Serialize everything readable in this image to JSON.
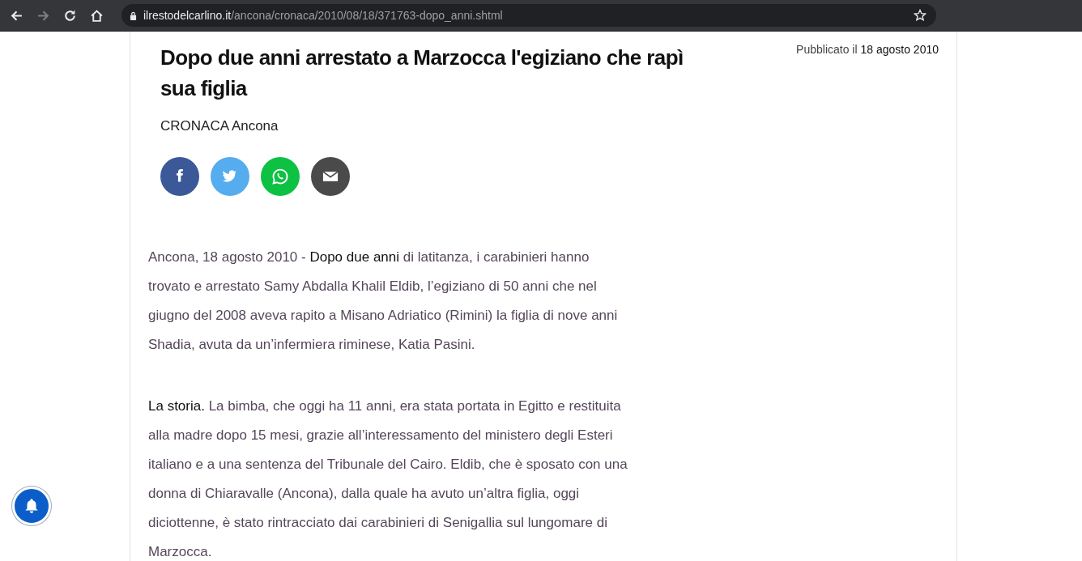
{
  "browser": {
    "url_domain": "ilrestodelcarlino.it",
    "url_path": "/ancona/cronaca/2010/08/18/371763-dopo_anni.shtml"
  },
  "article": {
    "title_lines": [
      "Dopo due anni arrestato a Marzocca l'egiziano che rapì",
      "sua figlia"
    ],
    "published": "Pubblicato il **18 agosto 2010**",
    "section": "CRONACA",
    "city": "Ancona",
    "share": [
      {
        "kind": "facebook",
        "color": "#3b5998"
      },
      {
        "kind": "twitter",
        "color": "#55acee"
      },
      {
        "kind": "whatsapp",
        "color": "#0dc143"
      },
      {
        "kind": "email",
        "color": "#4a4a4a"
      }
    ],
    "paragraphs": [
      [
        "Ancona, 18 agosto 2010 - **Dopo due anni** di latitanza, i carabinieri hanno",
        "trovato e arrestato Samy Abdalla Khalil Eldib, l’egiziano di 50 anni che nel",
        "giugno del 2008 aveva rapito a Misano Adriatico (Rimini) la figlia di nove anni",
        "Shadia, avuta da un’infermiera riminese, Katia Pasini."
      ],
      [
        "**La storia.** La bimba, che oggi ha 11 anni, era stata portata in Egitto e restituita",
        "alla madre dopo 15 mesi, grazie all’interessamento del ministero degli Esteri",
        "italiano e a una sentenza del Tribunale del Cairo. Eldib, che è sposato con una",
        "donna di Chiaravalle (Ancona), dalla quale ha avuto un’altra figlia, oggi",
        "diciottenne, è stato rintracciato dai carabinieri di Senigallia sul lungomare di",
        "Marzocca."
      ]
    ]
  }
}
